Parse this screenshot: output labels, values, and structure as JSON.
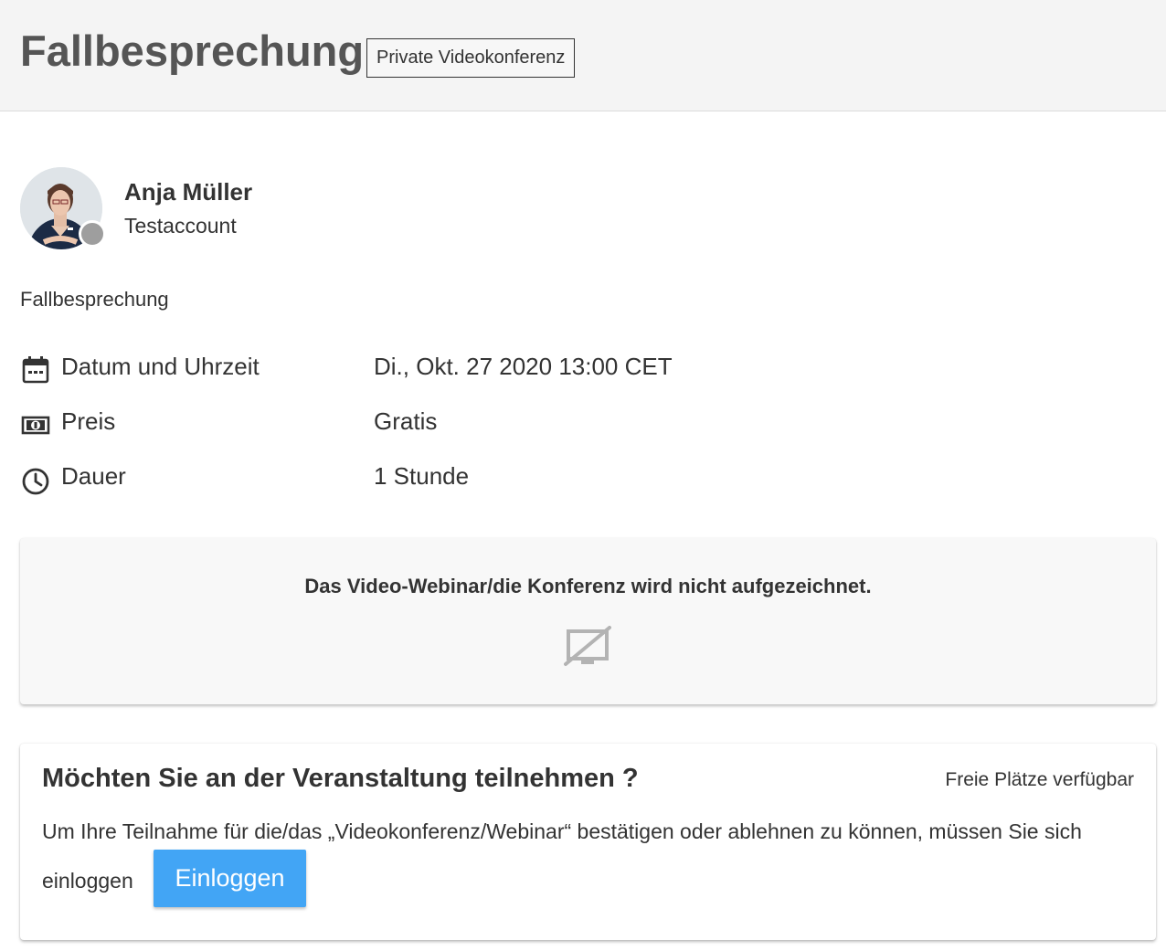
{
  "header": {
    "title": "Fallbesprechung",
    "badge": "Private Videokonferenz"
  },
  "host": {
    "name": "Anja Müller",
    "role": "Testaccount",
    "status_color": "#9e9e9e"
  },
  "event": {
    "description": "Fallbesprechung",
    "details": [
      {
        "icon": "calendar-icon",
        "label": "Datum und Uhrzeit",
        "value": "Di., Okt. 27 2020 13:00 CET"
      },
      {
        "icon": "money-icon",
        "label": "Preis",
        "value": "Gratis"
      },
      {
        "icon": "clock-icon",
        "label": "Dauer",
        "value": "1 Stunde"
      }
    ]
  },
  "recording": {
    "notice": "Das Video-Webinar/die Konferenz wird nicht aufgezeichnet.",
    "icon": "no-recording-icon"
  },
  "join": {
    "title": "Möchten Sie an der Veranstaltung teilnehmen ?",
    "seats": "Freie Plätze verfügbar",
    "text_line1": "Um Ihre Teilnahme für die/das „Videokonferenz/Webinar“ bestätigen oder ablehnen zu können, müssen Sie sich",
    "text_line2": "einloggen",
    "login_label": "Einloggen",
    "login_color": "#42a5f5"
  }
}
